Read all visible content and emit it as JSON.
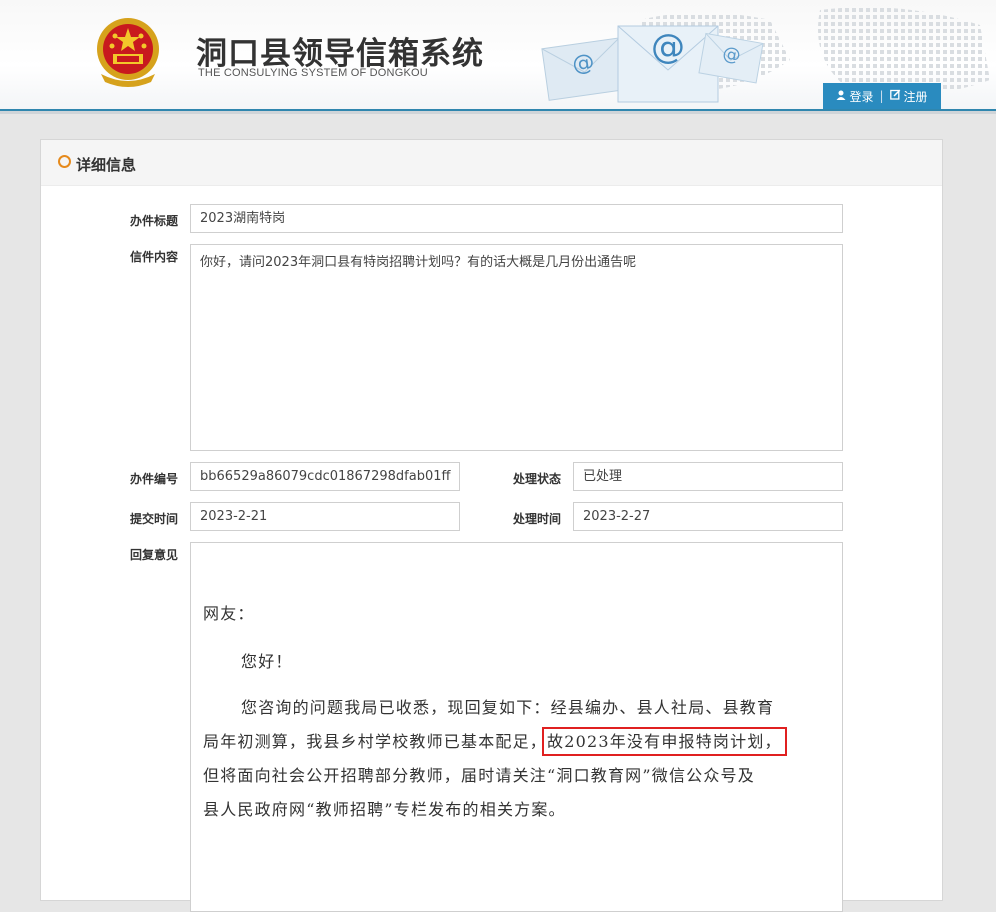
{
  "header": {
    "title": "洞口县领导信箱系统",
    "subtitle": "THE CONSULYING SYSTEM OF DONGKOU",
    "login_label": "登录",
    "register_label": "注册"
  },
  "panel": {
    "title": "详细信息"
  },
  "form": {
    "subject_label": "办件标题",
    "subject_value": "2023湖南特岗",
    "content_label": "信件内容",
    "content_value": "你好，请问2023年洞口县有特岗招聘计划吗？有的话大概是几月份出通告呢",
    "number_label": "办件编号",
    "number_value": "bb66529a86079cdc01867298dfab01ff",
    "status_label": "处理状态",
    "status_value": "已处理",
    "submit_time_label": "提交时间",
    "submit_time_value": "2023-2-21",
    "process_time_label": "处理时间",
    "process_time_value": "2023-2-27",
    "reply_label": "回复意见"
  },
  "reply": {
    "greeting": "网友：",
    "salutation": "您好！",
    "body_line1": "您咨询的问题我局已收悉，现回复如下：经县编办、县人社局、县教育",
    "body_line2_pre": "局年初测算，我县乡村学校教师已基本配足，",
    "body_highlight": "故2023年没有申报特岗计划，",
    "body_line3": "但将面向社会公开招聘部分教师，届时请关注“洞口教育网”微信公众号及",
    "body_line4": "县人民政府网“教师招聘”专栏发布的相关方案。"
  },
  "colors": {
    "accent_blue": "#2a8bbf",
    "header_rule": "#2f86ae",
    "section_ring": "#e68a1c",
    "highlight_box": "#e02020"
  }
}
